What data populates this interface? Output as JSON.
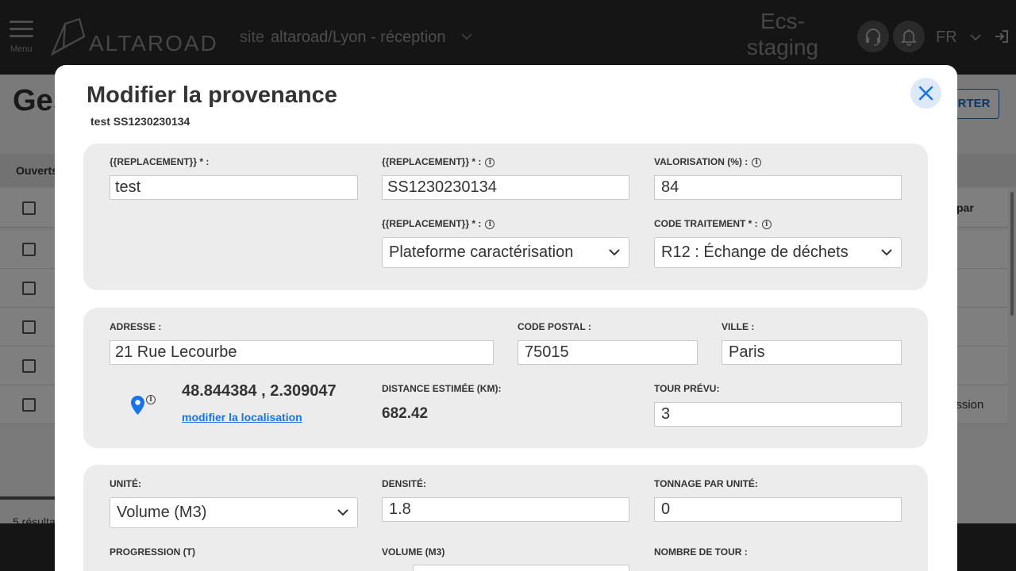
{
  "topbar": {
    "menu_label": "Menu",
    "logo_text": "ALTAROAD",
    "site_label": "site",
    "site_value": "altaroad/Lyon - réception",
    "env_line1": "Ecs-",
    "env_line2": "staging",
    "language": "FR",
    "icons": [
      "menu-icon",
      "headset-icon",
      "bell-icon",
      "chevron-down-icon",
      "logout-icon"
    ]
  },
  "background": {
    "page_title": "Ges",
    "export_button": "ORTER",
    "filter_tab": "Ouverts",
    "column_header_right": "par",
    "row_right_text": "ession",
    "results_text": "5 résulta"
  },
  "modal": {
    "title": "Modifier la provenance",
    "subtitle": "test SS1230230134",
    "section1": {
      "field1_label": "{{REPLACEMENT}} * :",
      "field1_value": "test",
      "field2_label": "{{REPLACEMENT}} * :",
      "field2_value": "SS1230230134",
      "valorisation_label": "VALORISATION (%) :",
      "valorisation_value": "84",
      "field3_label": "{{REPLACEMENT}} * :",
      "field3_selected": "Plateforme caractérisation",
      "code_traitement_label": "CODE TRAITEMENT * :",
      "code_traitement_selected": "R12 : Échange de déchets"
    },
    "section2": {
      "adresse_label": "ADRESSE :",
      "adresse_value": "21 Rue Lecourbe",
      "code_postal_label": "CODE POSTAL :",
      "code_postal_value": "75015",
      "ville_label": "VILLE :",
      "ville_value": "Paris",
      "coordinates": "48.844384 , 2.309047",
      "modifier_link": "modifier la localisation",
      "distance_label": "DISTANCE ESTIMÉE (KM):",
      "distance_value": "682.42",
      "tour_prevu_label": "TOUR PRÉVU:",
      "tour_prevu_value": "3"
    },
    "section3": {
      "unite_label": "UNITÉ:",
      "unite_selected": "Volume (M3)",
      "densite_label": "DENSITÉ:",
      "densite_value": "1.8",
      "tonnage_label": "TONNAGE PAR UNITÉ:",
      "tonnage_value": "0",
      "progression_label": "PROGRESSION (T)",
      "volume_label": "VOLUME (M3)",
      "nombre_tour_label": "NOMBRE DE TOUR :"
    }
  },
  "colors": {
    "topbar": "#2b2b2b",
    "accent_blue": "#1a73e8",
    "section_bg": "#ececec"
  }
}
